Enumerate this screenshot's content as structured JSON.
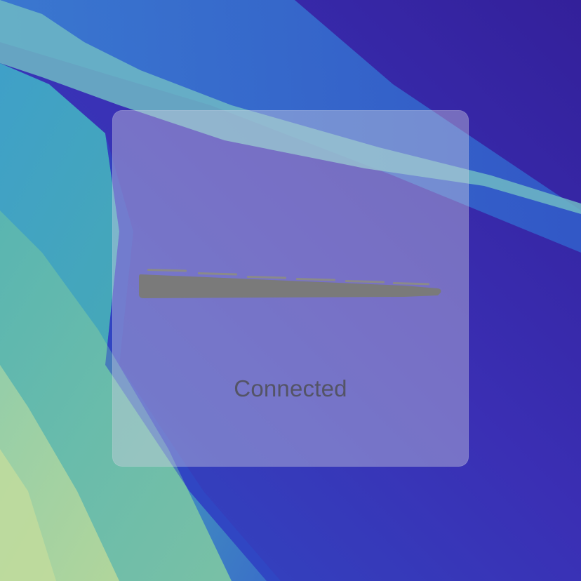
{
  "hud": {
    "status": "Connected",
    "icon": "keyboard-side-icon"
  },
  "colors": {
    "wallpaper_deep": "#3622a2",
    "wallpaper_mid": "#3040c0",
    "wallpaper_teal": "#4aa6b8",
    "wallpaper_light": "#8cc8a8",
    "hud_background": "#cdcde1",
    "icon": "#7a7a7a",
    "status_text": "#545466"
  }
}
